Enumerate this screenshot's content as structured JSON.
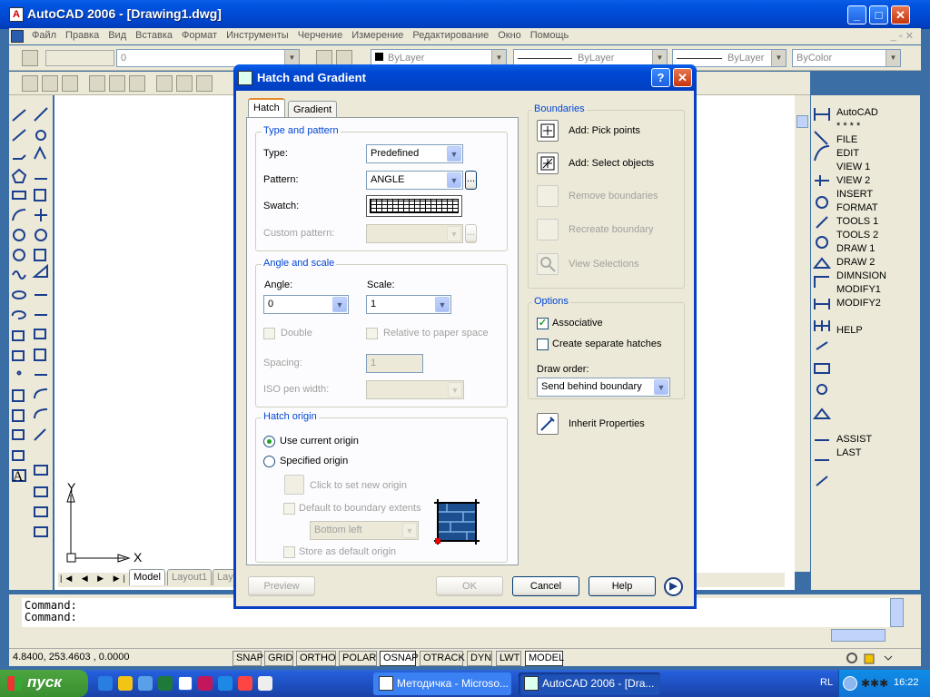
{
  "window": {
    "title": "AutoCAD 2006 - [Drawing1.dwg]"
  },
  "menu": [
    "Файл",
    "Правка",
    "Вид",
    "Вставка",
    "Формат",
    "Инструменты",
    "Черчение",
    "Измерение",
    "Редактирование",
    "Окно",
    "Помощь"
  ],
  "layer_toolbar": {
    "layer_value": "0",
    "linetype_color": "ByLayer",
    "linetype": "ByLayer",
    "lineweight": "ByLayer",
    "plot_style": "ByColor"
  },
  "side_menu": [
    "AutoCAD",
    "* * * *",
    "FILE",
    "EDIT",
    "VIEW 1",
    "VIEW 2",
    "INSERT",
    "FORMAT",
    "TOOLS 1",
    "TOOLS 2",
    "DRAW 1",
    "DRAW 2",
    "DIMNSION",
    "MODIFY1",
    "MODIFY2",
    "",
    "HELP",
    "",
    "",
    "",
    "",
    "",
    "",
    "",
    "ASSIST",
    "LAST"
  ],
  "canvas": {
    "ucs_x": "X",
    "ucs_y": "Y",
    "layout_tabs": [
      "Model",
      "Layout1",
      "Layo"
    ]
  },
  "command": {
    "line1": "Command:",
    "line2": "Command:"
  },
  "status": {
    "coords": "4.8400,  253.4603 , 0.0000",
    "buttons": [
      "SNAP",
      "GRID",
      "ORTHO",
      "POLAR",
      "OSNAP",
      "OTRACK",
      "DYN",
      "LWT",
      "MODEL"
    ]
  },
  "dialog": {
    "title": "Hatch and Gradient",
    "tabs": [
      "Hatch",
      "Gradient"
    ],
    "type_and_pattern": {
      "group": "Type and pattern",
      "type_label": "Type:",
      "type_value": "Predefined",
      "pattern_label": "Pattern:",
      "pattern_value": "ANGLE",
      "swatch_label": "Swatch:",
      "custom_label": "Custom pattern:",
      "browse": "..."
    },
    "angle_and_scale": {
      "group": "Angle and scale",
      "angle_label": "Angle:",
      "angle_value": "0",
      "scale_label": "Scale:",
      "scale_value": "1",
      "double_label": "Double",
      "relative_label": "Relative to paper space",
      "spacing_label": "Spacing:",
      "spacing_value": "1",
      "iso_label": "ISO pen width:"
    },
    "hatch_origin": {
      "group": "Hatch origin",
      "use_current": "Use current origin",
      "specified": "Specified origin",
      "click_to_set": "Click to set new origin",
      "default_boundary": "Default to boundary extents",
      "position_value": "Bottom left",
      "store_default": "Store as default origin"
    },
    "boundaries": {
      "group": "Boundaries",
      "pick_points": "Add: Pick points",
      "select_objects": "Add: Select objects",
      "remove": "Remove boundaries",
      "recreate": "Recreate boundary",
      "view": "View Selections"
    },
    "options": {
      "group": "Options",
      "associative": "Associative",
      "separate": "Create separate hatches",
      "draw_order_label": "Draw order:",
      "draw_order_value": "Send behind boundary"
    },
    "inherit": "Inherit Properties",
    "buttons": {
      "preview": "Preview",
      "ok": "OK",
      "cancel": "Cancel",
      "help": "Help"
    },
    "help_glyph": "?"
  },
  "taskbar": {
    "start": "пуск",
    "tasks": [
      "Методичка - Microso...",
      "AutoCAD 2006 - [Dra..."
    ],
    "lang": "RL",
    "clock": "16:22"
  },
  "colors": {
    "xp_blue": "#0053e0",
    "dialog_bg": "#ece9d8",
    "group_label": "#0046d5",
    "start_green": "#3a8e2f"
  }
}
